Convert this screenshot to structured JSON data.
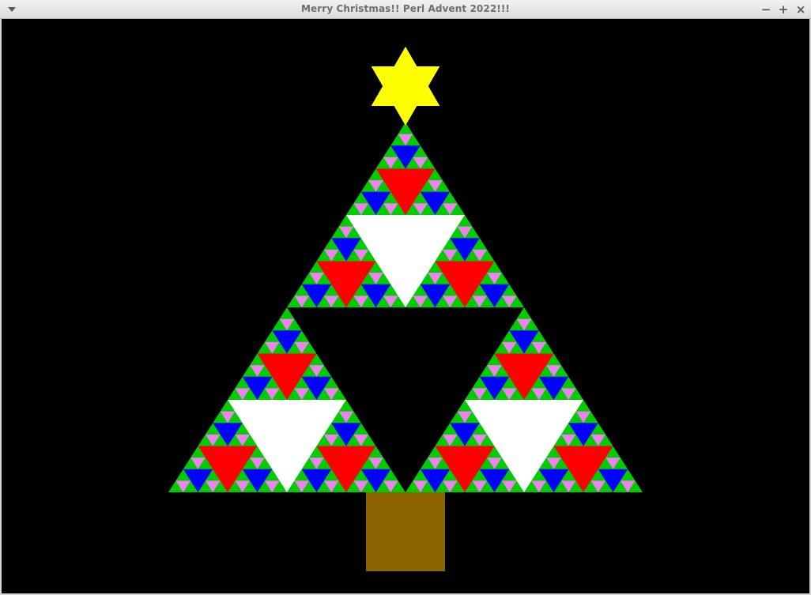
{
  "window": {
    "title": "Merry Christmas!!  Perl Advent 2022!!!",
    "controls": {
      "minimize": "−",
      "maximize": "+",
      "close": "×"
    }
  },
  "scene": {
    "background": "#000000",
    "tree_green": "#00cc00",
    "level_colors": {
      "level1": "#000000",
      "level2": "#ffffff",
      "level3": "#ff0000",
      "level4": "#0000ff",
      "level5": "#ee82ee"
    },
    "star_color": "#ffff00",
    "trunk_color": "#8b6400",
    "fractal_depth": 5
  }
}
